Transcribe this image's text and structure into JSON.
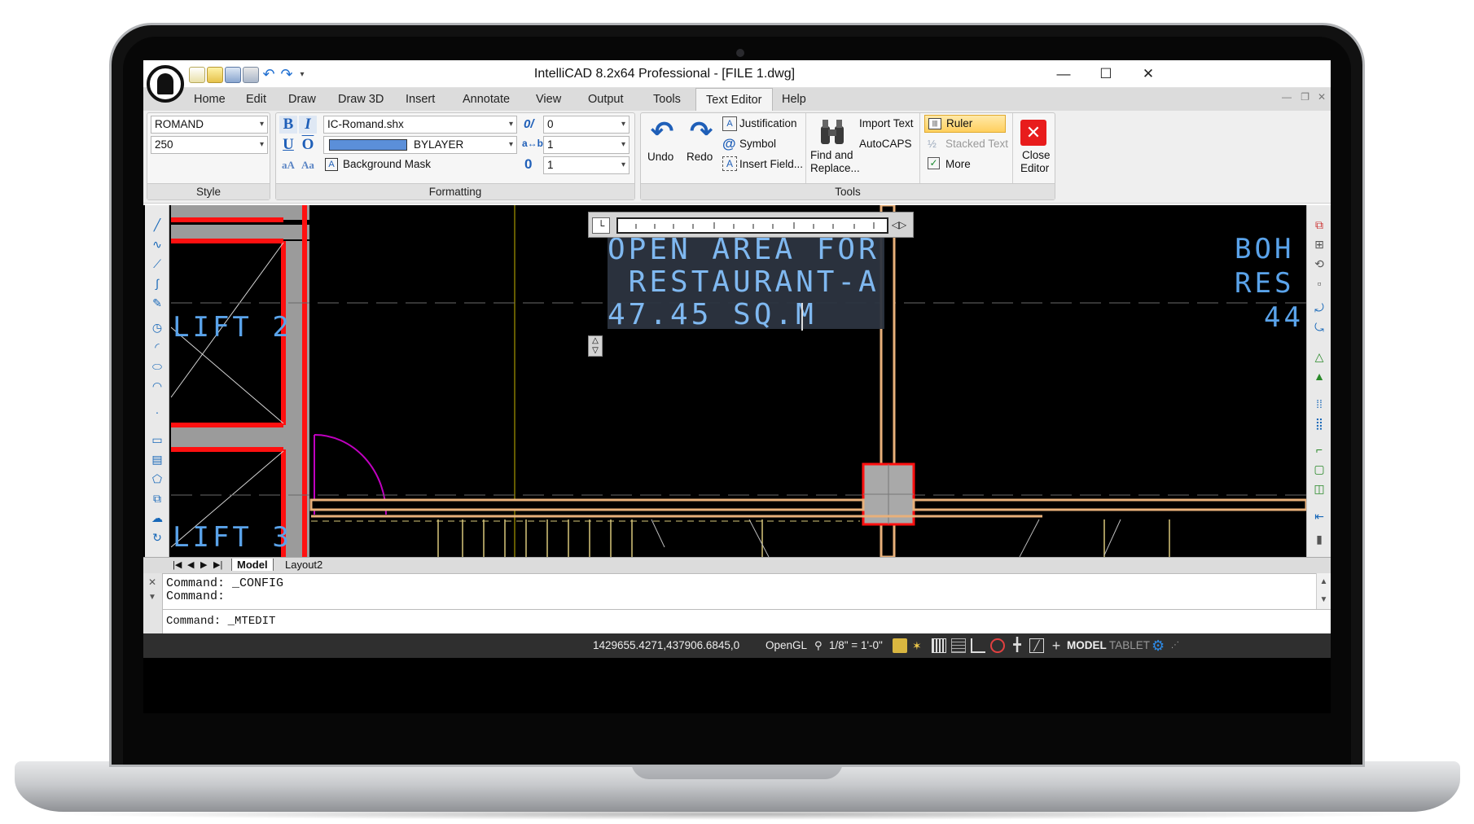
{
  "window": {
    "title": "IntelliCAD 8.2x64 Professional - [FILE 1.dwg]",
    "controls": {
      "minimize": "—",
      "maximize": "☐",
      "close": "✕"
    }
  },
  "menu_tabs": [
    "Home",
    "Edit",
    "Draw",
    "Draw 3D",
    "Insert",
    "Annotate",
    "View",
    "Output",
    "Tools",
    "Text Editor",
    "Help"
  ],
  "active_tab": "Text Editor",
  "ribbon": {
    "style": {
      "title": "Style",
      "font_style": "ROMAND",
      "height": "250"
    },
    "formatting": {
      "title": "Formatting",
      "bold": "B",
      "italic": "I",
      "underline": "U",
      "overline": "O",
      "case_upper": "aA",
      "case_lower": "Aa",
      "font": "IC-Romand.shx",
      "color": "BYLAYER",
      "color_swatch": "#5b8fd9",
      "background_mask": "Background Mask",
      "oblique_icon": "0/",
      "oblique_value": "0",
      "tracking_icon": "a↔b",
      "tracking_value": "1",
      "width_icon": "0",
      "width_value": "1"
    },
    "tools": {
      "title": "Tools",
      "undo": "Undo",
      "redo": "Redo",
      "justification": "Justification",
      "symbol": "Symbol",
      "insert_field": "Insert Field...",
      "find_replace_line1": "Find and",
      "find_replace_line2": "Replace...",
      "import_text": "Import Text",
      "autocaps": "AutoCAPS",
      "ruler": "Ruler",
      "stacked_text": "Stacked Text",
      "more": "More",
      "close_editor_line1": "Close",
      "close_editor_line2": "Editor"
    }
  },
  "drawing": {
    "mtext_lines": [
      "OPEN AREA FOR",
      " RESTAURANT-A",
      "47.45 SQ.M"
    ],
    "label_lift2": "LIFT 2",
    "label_lift3": "LIFT 3",
    "label_right_1": "BOH",
    "label_right_2": "RES",
    "label_right_3": "44"
  },
  "layout_tabs": [
    "Model",
    "Layout2"
  ],
  "command": {
    "history": [
      "Command:  _CONFIG",
      "Command:"
    ],
    "input": "Command:  _MTEDIT"
  },
  "status": {
    "coordinates": "1429655.4271,437906.6845,0",
    "renderer": "OpenGL",
    "scale": "1/8\" = 1'-0\"",
    "model": "MODEL",
    "tablet": "TABLET"
  },
  "colors": {
    "cad_text": "#5aa3ea",
    "wall_red": "#ff1010",
    "beam_tan": "#e8b07a",
    "status_bg": "#2f2f2f"
  }
}
